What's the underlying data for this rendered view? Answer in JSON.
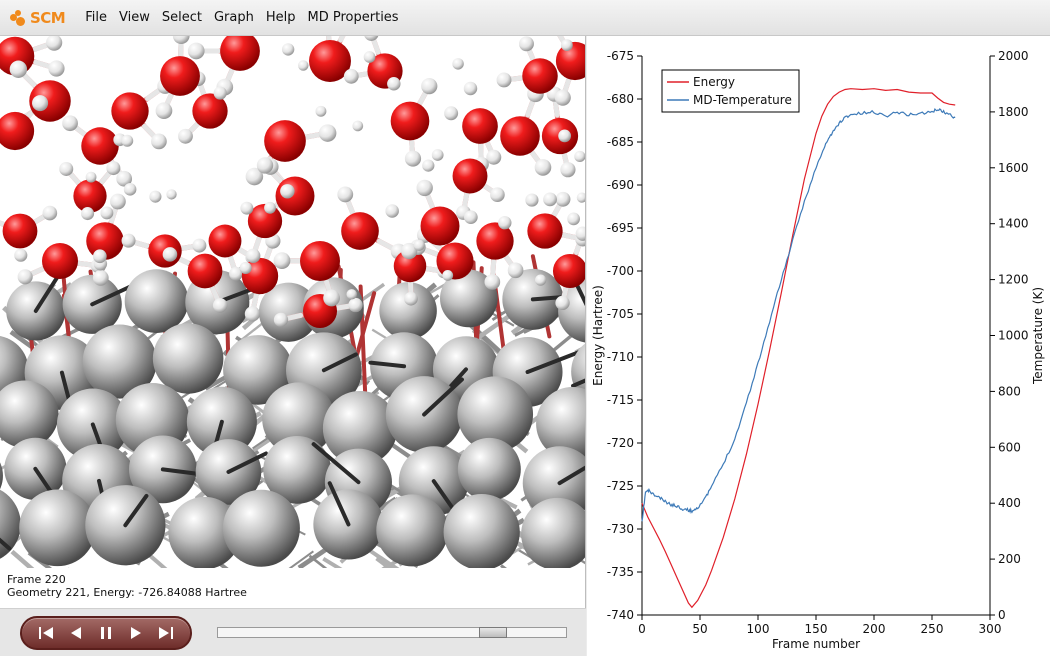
{
  "app": {
    "logo_text": "SCM",
    "accent_color": "#f08a1c"
  },
  "menubar": {
    "items": [
      {
        "label": "File"
      },
      {
        "label": "View"
      },
      {
        "label": "Select"
      },
      {
        "label": "Graph"
      },
      {
        "label": "Help"
      },
      {
        "label": "MD Properties"
      }
    ]
  },
  "info": {
    "frame": "Frame 220",
    "geometry": "Geometry 221, Energy: -726.84088 Hartree"
  },
  "player": {
    "buttons": [
      "skip-to-start-icon",
      "step-back-icon",
      "pause-icon",
      "step-forward-icon",
      "skip-to-end-icon"
    ],
    "slider_fraction": 0.815
  },
  "chart_data": {
    "type": "line",
    "xlabel": "Frame number",
    "ylabel": "Energy (Hartree)",
    "y2label": "Temperature (K)",
    "xlim": [
      0,
      300
    ],
    "ylim": [
      -740,
      -675
    ],
    "y2lim": [
      0,
      2000
    ],
    "xticks": [
      0,
      50,
      100,
      150,
      200,
      250,
      300
    ],
    "yticks": [
      -740,
      -735,
      -730,
      -725,
      -720,
      -715,
      -710,
      -705,
      -700,
      -695,
      -690,
      -685,
      -680,
      -675
    ],
    "y2ticks": [
      0,
      200,
      400,
      600,
      800,
      1000,
      1200,
      1400,
      1600,
      1800,
      2000
    ],
    "legend_position": "top-left",
    "grid": false,
    "series": [
      {
        "name": "Energy",
        "axis": "left",
        "color": "#e0202a",
        "x": [
          0,
          5,
          10,
          15,
          20,
          25,
          30,
          35,
          40,
          43,
          48,
          55,
          60,
          70,
          80,
          90,
          100,
          110,
          120,
          130,
          140,
          150,
          155,
          160,
          165,
          170,
          175,
          180,
          190,
          200,
          210,
          220,
          230,
          240,
          250,
          255,
          260,
          265,
          270
        ],
        "y": [
          -727,
          -728.6,
          -729.9,
          -731.2,
          -732.6,
          -734.1,
          -735.6,
          -737.1,
          -738.6,
          -739.1,
          -738.3,
          -736.5,
          -734.8,
          -731.0,
          -726.5,
          -721.3,
          -715.5,
          -709.2,
          -702.6,
          -695.8,
          -689.3,
          -684.0,
          -682.0,
          -680.6,
          -679.7,
          -679.2,
          -678.9,
          -678.8,
          -678.9,
          -678.8,
          -679.0,
          -678.9,
          -679.2,
          -679.3,
          -679.3,
          -679.9,
          -680.4,
          -680.6,
          -680.7
        ]
      },
      {
        "name": "MD-Temperature",
        "axis": "right",
        "color": "#3d7ab8",
        "x": [
          0,
          3,
          6,
          10,
          15,
          20,
          25,
          30,
          35,
          40,
          43,
          48,
          55,
          60,
          70,
          80,
          90,
          100,
          110,
          120,
          130,
          140,
          150,
          155,
          160,
          165,
          170,
          175,
          180,
          190,
          200,
          210,
          220,
          230,
          240,
          250,
          255,
          260,
          265,
          270
        ],
        "y": [
          330,
          440,
          445,
          430,
          420,
          405,
          395,
          390,
          380,
          375,
          372,
          385,
          420,
          460,
          540,
          630,
          760,
          900,
          1050,
          1200,
          1340,
          1480,
          1600,
          1650,
          1700,
          1730,
          1760,
          1780,
          1790,
          1795,
          1800,
          1785,
          1800,
          1790,
          1795,
          1800,
          1810,
          1800,
          1790,
          1780
        ]
      }
    ]
  }
}
